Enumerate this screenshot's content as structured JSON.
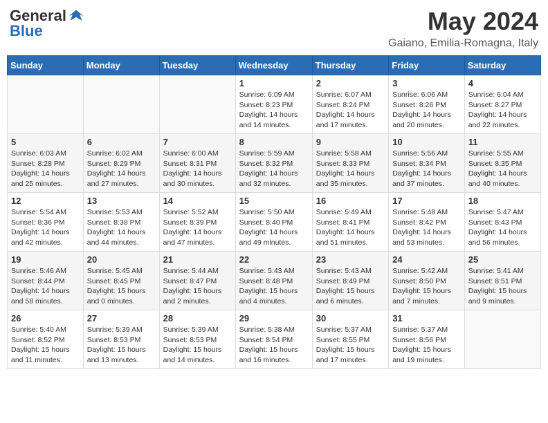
{
  "header": {
    "logo_general": "General",
    "logo_blue": "Blue",
    "month": "May 2024",
    "location": "Gaiano, Emilia-Romagna, Italy"
  },
  "days_of_week": [
    "Sunday",
    "Monday",
    "Tuesday",
    "Wednesday",
    "Thursday",
    "Friday",
    "Saturday"
  ],
  "weeks": [
    [
      {
        "day": "",
        "info": ""
      },
      {
        "day": "",
        "info": ""
      },
      {
        "day": "",
        "info": ""
      },
      {
        "day": "1",
        "info": "Sunrise: 6:09 AM\nSunset: 8:23 PM\nDaylight: 14 hours and 14 minutes."
      },
      {
        "day": "2",
        "info": "Sunrise: 6:07 AM\nSunset: 8:24 PM\nDaylight: 14 hours and 17 minutes."
      },
      {
        "day": "3",
        "info": "Sunrise: 6:06 AM\nSunset: 8:26 PM\nDaylight: 14 hours and 20 minutes."
      },
      {
        "day": "4",
        "info": "Sunrise: 6:04 AM\nSunset: 8:27 PM\nDaylight: 14 hours and 22 minutes."
      }
    ],
    [
      {
        "day": "5",
        "info": "Sunrise: 6:03 AM\nSunset: 8:28 PM\nDaylight: 14 hours and 25 minutes."
      },
      {
        "day": "6",
        "info": "Sunrise: 6:02 AM\nSunset: 8:29 PM\nDaylight: 14 hours and 27 minutes."
      },
      {
        "day": "7",
        "info": "Sunrise: 6:00 AM\nSunset: 8:31 PM\nDaylight: 14 hours and 30 minutes."
      },
      {
        "day": "8",
        "info": "Sunrise: 5:59 AM\nSunset: 8:32 PM\nDaylight: 14 hours and 32 minutes."
      },
      {
        "day": "9",
        "info": "Sunrise: 5:58 AM\nSunset: 8:33 PM\nDaylight: 14 hours and 35 minutes."
      },
      {
        "day": "10",
        "info": "Sunrise: 5:56 AM\nSunset: 8:34 PM\nDaylight: 14 hours and 37 minutes."
      },
      {
        "day": "11",
        "info": "Sunrise: 5:55 AM\nSunset: 8:35 PM\nDaylight: 14 hours and 40 minutes."
      }
    ],
    [
      {
        "day": "12",
        "info": "Sunrise: 5:54 AM\nSunset: 8:36 PM\nDaylight: 14 hours and 42 minutes."
      },
      {
        "day": "13",
        "info": "Sunrise: 5:53 AM\nSunset: 8:38 PM\nDaylight: 14 hours and 44 minutes."
      },
      {
        "day": "14",
        "info": "Sunrise: 5:52 AM\nSunset: 8:39 PM\nDaylight: 14 hours and 47 minutes."
      },
      {
        "day": "15",
        "info": "Sunrise: 5:50 AM\nSunset: 8:40 PM\nDaylight: 14 hours and 49 minutes."
      },
      {
        "day": "16",
        "info": "Sunrise: 5:49 AM\nSunset: 8:41 PM\nDaylight: 14 hours and 51 minutes."
      },
      {
        "day": "17",
        "info": "Sunrise: 5:48 AM\nSunset: 8:42 PM\nDaylight: 14 hours and 53 minutes."
      },
      {
        "day": "18",
        "info": "Sunrise: 5:47 AM\nSunset: 8:43 PM\nDaylight: 14 hours and 56 minutes."
      }
    ],
    [
      {
        "day": "19",
        "info": "Sunrise: 5:46 AM\nSunset: 8:44 PM\nDaylight: 14 hours and 58 minutes."
      },
      {
        "day": "20",
        "info": "Sunrise: 5:45 AM\nSunset: 8:45 PM\nDaylight: 15 hours and 0 minutes."
      },
      {
        "day": "21",
        "info": "Sunrise: 5:44 AM\nSunset: 8:47 PM\nDaylight: 15 hours and 2 minutes."
      },
      {
        "day": "22",
        "info": "Sunrise: 5:43 AM\nSunset: 8:48 PM\nDaylight: 15 hours and 4 minutes."
      },
      {
        "day": "23",
        "info": "Sunrise: 5:43 AM\nSunset: 8:49 PM\nDaylight: 15 hours and 6 minutes."
      },
      {
        "day": "24",
        "info": "Sunrise: 5:42 AM\nSunset: 8:50 PM\nDaylight: 15 hours and 7 minutes."
      },
      {
        "day": "25",
        "info": "Sunrise: 5:41 AM\nSunset: 8:51 PM\nDaylight: 15 hours and 9 minutes."
      }
    ],
    [
      {
        "day": "26",
        "info": "Sunrise: 5:40 AM\nSunset: 8:52 PM\nDaylight: 15 hours and 11 minutes."
      },
      {
        "day": "27",
        "info": "Sunrise: 5:39 AM\nSunset: 8:53 PM\nDaylight: 15 hours and 13 minutes."
      },
      {
        "day": "28",
        "info": "Sunrise: 5:39 AM\nSunset: 8:53 PM\nDaylight: 15 hours and 14 minutes."
      },
      {
        "day": "29",
        "info": "Sunrise: 5:38 AM\nSunset: 8:54 PM\nDaylight: 15 hours and 16 minutes."
      },
      {
        "day": "30",
        "info": "Sunrise: 5:37 AM\nSunset: 8:55 PM\nDaylight: 15 hours and 17 minutes."
      },
      {
        "day": "31",
        "info": "Sunrise: 5:37 AM\nSunset: 8:56 PM\nDaylight: 15 hours and 19 minutes."
      },
      {
        "day": "",
        "info": ""
      }
    ]
  ]
}
